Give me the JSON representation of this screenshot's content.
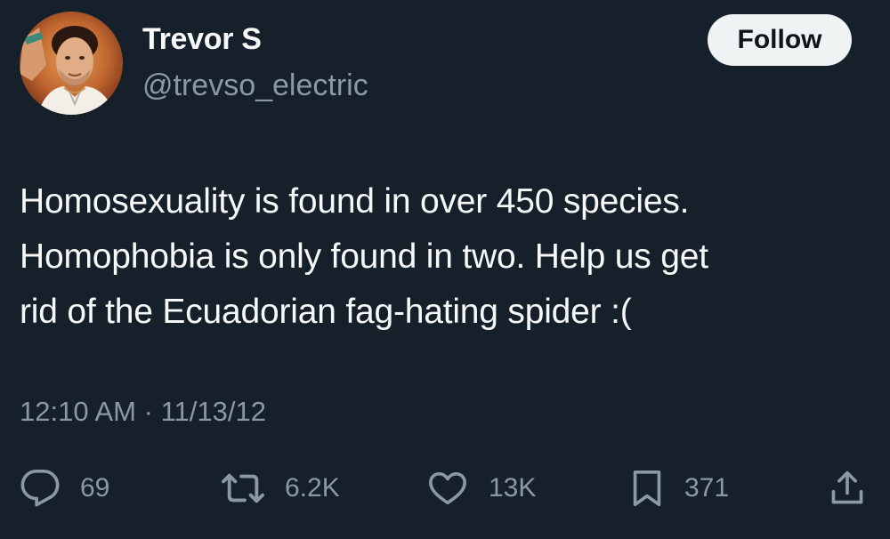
{
  "author": {
    "name": "Trevor S",
    "handle": "@trevso_electric",
    "avatar_icon": "user-avatar-photo"
  },
  "follow_button": {
    "label": "Follow"
  },
  "tweet": {
    "lines": [
      "Homosexuality is found in over 450 species.",
      "Homophobia is only found in two.  Help us get",
      "rid of the Ecuadorian fag-hating spider :("
    ],
    "time": "12:10 AM",
    "separator": "·",
    "date": "11/13/12"
  },
  "actions": {
    "reply": {
      "icon": "reply-icon",
      "count": "69"
    },
    "retweet": {
      "icon": "retweet-icon",
      "count": "6.2K"
    },
    "like": {
      "icon": "heart-icon",
      "count": "13K"
    },
    "bookmark": {
      "icon": "bookmark-icon",
      "count": "371"
    },
    "share": {
      "icon": "share-icon"
    }
  },
  "colors": {
    "background": "#15202b",
    "text_primary": "#f7f9f9",
    "text_secondary": "#8b98a5",
    "button_bg": "#eff3f4",
    "button_text": "#0f1419"
  }
}
